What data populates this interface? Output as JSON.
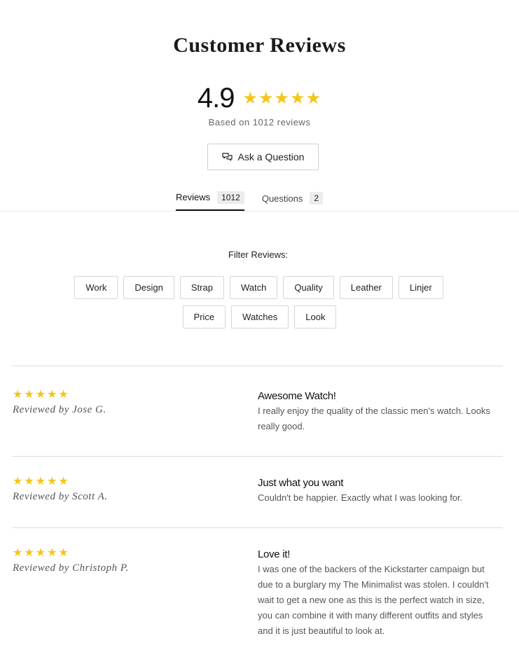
{
  "title": "Customer Reviews",
  "summary": {
    "average": "4.9",
    "rating": 5,
    "based_on": "Based on 1012 reviews"
  },
  "ask_button": {
    "label": "Ask a Question",
    "icon": "chat-bubbles-icon"
  },
  "tabs": [
    {
      "label": "Reviews",
      "count": "1012",
      "active": true
    },
    {
      "label": "Questions",
      "count": "2",
      "active": false
    }
  ],
  "filter": {
    "label": "Filter Reviews:",
    "chips_row1": [
      "Work",
      "Design",
      "Strap",
      "Watch",
      "Quality",
      "Leather",
      "Linjer"
    ],
    "chips_row2": [
      "Price",
      "Watches",
      "Look"
    ]
  },
  "reviews": [
    {
      "rating": 5,
      "reviewer": "Reviewed by Jose G.",
      "title": "Awesome Watch!",
      "body": "I really enjoy the quality of the classic men's watch. Looks really good."
    },
    {
      "rating": 5,
      "reviewer": "Reviewed by Scott A.",
      "title": "Just what you want",
      "body": "Couldn't be happier. Exactly what I was looking for."
    },
    {
      "rating": 5,
      "reviewer": "Reviewed by Christoph P.",
      "title": "Love it!",
      "body": "I was one of the backers of the Kickstarter campaign but due to a burglary my The Minimalist was stolen. I couldn't wait to get a new one as this is the perfect watch in size, you can combine it with many different outfits and styles and it is just beautiful to look at."
    }
  ],
  "colors": {
    "star": "#f5c518",
    "text": "#222222",
    "muted": "#555555",
    "border": "#dcdcdc"
  }
}
